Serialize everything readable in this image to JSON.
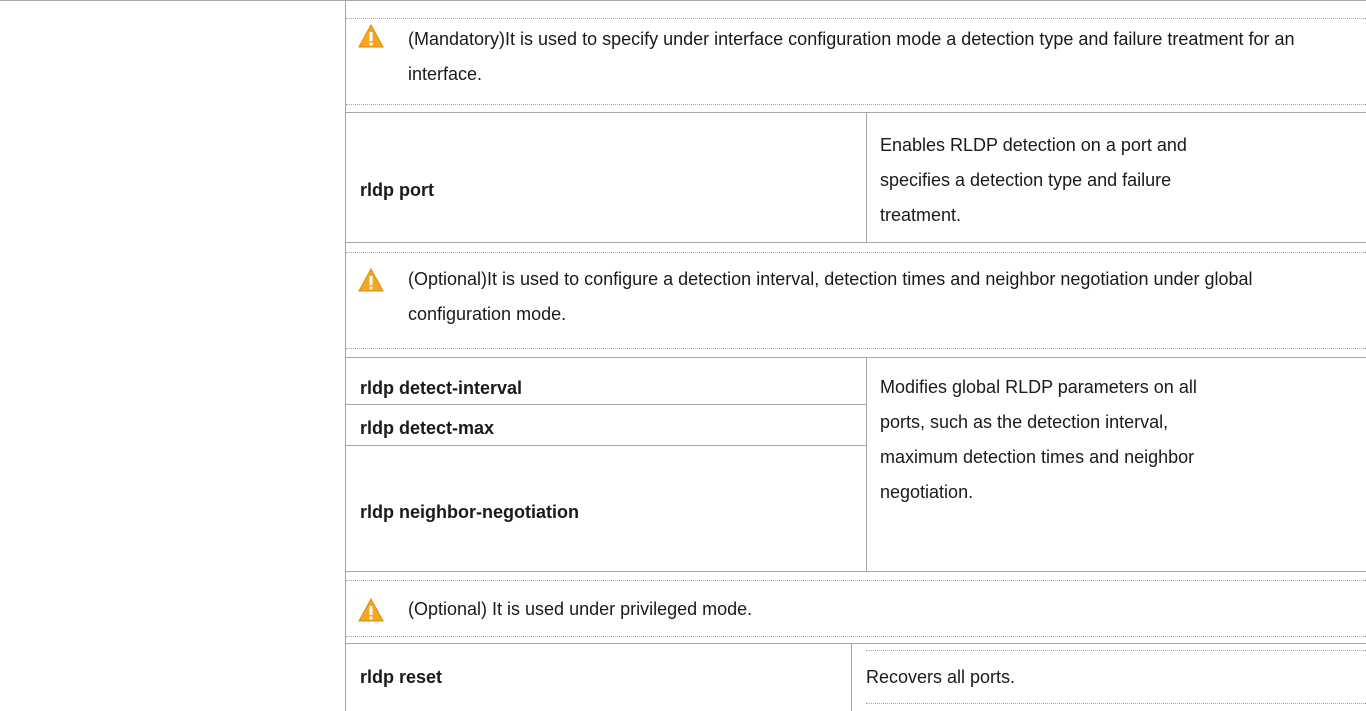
{
  "notes": [
    {
      "icon": "warning-icon",
      "text": "(Mandatory)It is used to specify under interface configuration mode a detection type and failure treatment for an interface."
    },
    {
      "icon": "warning-icon",
      "text": "(Optional)It is used to configure a detection interval, detection times and neighbor negotiation under global configuration mode."
    },
    {
      "icon": "warning-icon",
      "text": "(Optional) It is used under privileged mode."
    }
  ],
  "rows": {
    "port": {
      "command": "rldp port",
      "description": "Enables RLDP detection on a port and specifies a detection type and failure treatment."
    },
    "global": {
      "commands": [
        "rldp detect-interval",
        "rldp detect-max",
        "rldp neighbor-negotiation"
      ],
      "description": "Modifies global RLDP parameters on all ports, such as the detection interval, maximum detection times and neighbor negotiation."
    },
    "reset": {
      "command": "rldp reset",
      "description": "Recovers all ports."
    }
  },
  "colors": {
    "warning": "#f5a623",
    "border": "#a6a6a6"
  }
}
